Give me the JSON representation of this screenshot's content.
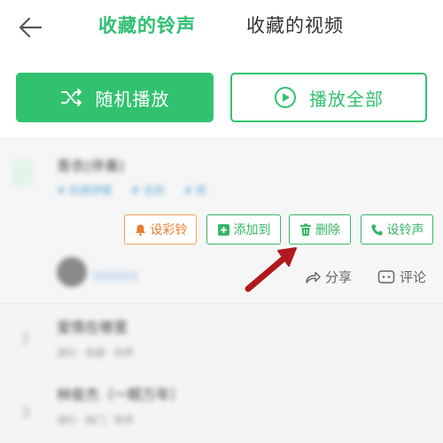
{
  "header": {
    "tabs": [
      {
        "label": "收藏的铃声",
        "active": true
      },
      {
        "label": "收藏的视频",
        "active": false
      }
    ]
  },
  "actions": {
    "random_play": "随机播放",
    "play_all": "播放全部"
  },
  "expanded_song": {
    "title": "青衣(伴奏)",
    "tags": [
      "# 伤感抒情",
      "# 古风",
      "# 民"
    ],
    "buttons": {
      "ringback": "设彩铃",
      "add_to": "添加到",
      "delete": "删除",
      "set_ringtone": "设铃声"
    },
    "share": "分享",
    "comment": "评论"
  },
  "songs": [
    {
      "index": "2",
      "title": "爱情在哪里",
      "meta": "流行 · 伤感 · 铃声"
    },
    {
      "index": "3",
      "title": "林俊杰（一眼万年）",
      "meta": "流行 · 热门 · 铃声"
    }
  ],
  "colors": {
    "accent": "#32c26f",
    "ringback": "#ec7d2c",
    "arrow": "#b0191e"
  }
}
